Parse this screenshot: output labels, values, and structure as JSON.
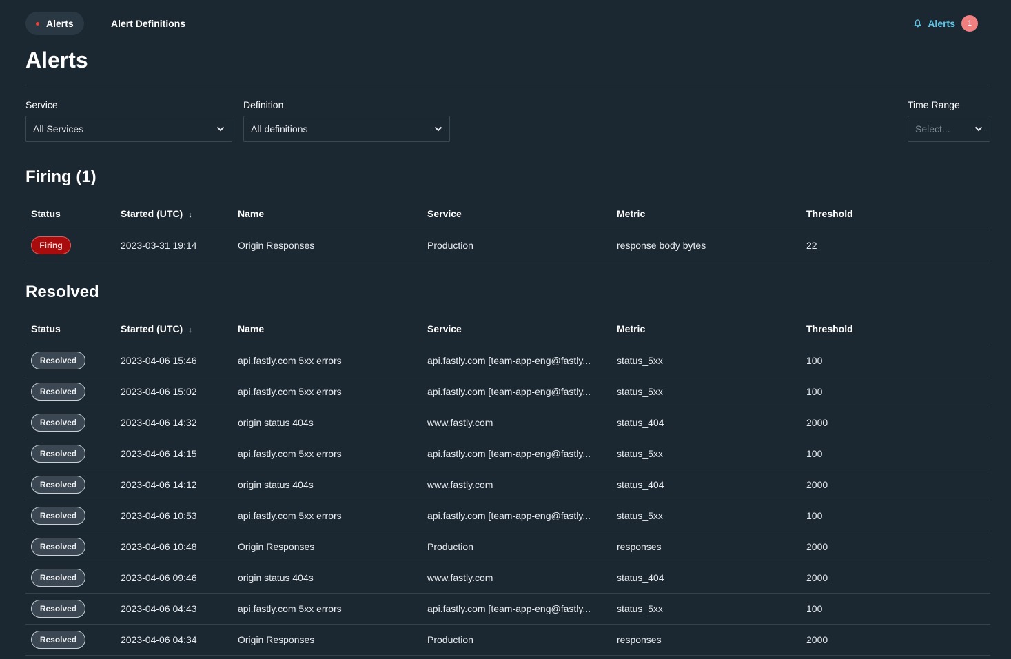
{
  "nav": {
    "tabs": [
      {
        "label": "Alerts",
        "active": true
      },
      {
        "label": "Alert Definitions",
        "active": false
      }
    ],
    "alerts_link": {
      "label": "Alerts",
      "icon": "bell-icon",
      "count": "1"
    }
  },
  "page_title": "Alerts",
  "filters": {
    "service": {
      "label": "Service",
      "value": "All Services"
    },
    "definition": {
      "label": "Definition",
      "value": "All definitions"
    },
    "time_range": {
      "label": "Time Range",
      "placeholder": "Select..."
    }
  },
  "columns": {
    "status": "Status",
    "started": "Started (UTC)",
    "name": "Name",
    "service": "Service",
    "metric": "Metric",
    "threshold": "Threshold",
    "sort_indicator": "↓"
  },
  "firing": {
    "title": "Firing (1)",
    "rows": [
      {
        "status": "Firing",
        "started": "2023-03-31 19:14",
        "name": "Origin Responses",
        "service": "Production",
        "metric": "response body bytes",
        "threshold": "22"
      }
    ]
  },
  "resolved": {
    "title": "Resolved",
    "rows": [
      {
        "status": "Resolved",
        "started": "2023-04-06 15:46",
        "name": "api.fastly.com 5xx errors",
        "service": "api.fastly.com [team-app-eng@fastly...",
        "metric": "status_5xx",
        "threshold": "100"
      },
      {
        "status": "Resolved",
        "started": "2023-04-06 15:02",
        "name": "api.fastly.com 5xx errors",
        "service": "api.fastly.com [team-app-eng@fastly...",
        "metric": "status_5xx",
        "threshold": "100"
      },
      {
        "status": "Resolved",
        "started": "2023-04-06 14:32",
        "name": "origin status 404s",
        "service": "www.fastly.com",
        "metric": "status_404",
        "threshold": "2000"
      },
      {
        "status": "Resolved",
        "started": "2023-04-06 14:15",
        "name": "api.fastly.com 5xx errors",
        "service": "api.fastly.com [team-app-eng@fastly...",
        "metric": "status_5xx",
        "threshold": "100"
      },
      {
        "status": "Resolved",
        "started": "2023-04-06 14:12",
        "name": "origin status 404s",
        "service": "www.fastly.com",
        "metric": "status_404",
        "threshold": "2000"
      },
      {
        "status": "Resolved",
        "started": "2023-04-06 10:53",
        "name": "api.fastly.com 5xx errors",
        "service": "api.fastly.com [team-app-eng@fastly...",
        "metric": "status_5xx",
        "threshold": "100"
      },
      {
        "status": "Resolved",
        "started": "2023-04-06 10:48",
        "name": "Origin Responses",
        "service": "Production",
        "metric": "responses",
        "threshold": "2000"
      },
      {
        "status": "Resolved",
        "started": "2023-04-06 09:46",
        "name": "origin status 404s",
        "service": "www.fastly.com",
        "metric": "status_404",
        "threshold": "2000"
      },
      {
        "status": "Resolved",
        "started": "2023-04-06 04:43",
        "name": "api.fastly.com 5xx errors",
        "service": "api.fastly.com [team-app-eng@fastly...",
        "metric": "status_5xx",
        "threshold": "100"
      },
      {
        "status": "Resolved",
        "started": "2023-04-06 04:34",
        "name": "Origin Responses",
        "service": "Production",
        "metric": "responses",
        "threshold": "2000"
      }
    ]
  },
  "colors": {
    "background": "#1b2731",
    "firing_badge": "#a80c0c",
    "resolved_badge": "#3b4752",
    "accent": "#5dc6e8",
    "count_badge": "#f08080"
  }
}
